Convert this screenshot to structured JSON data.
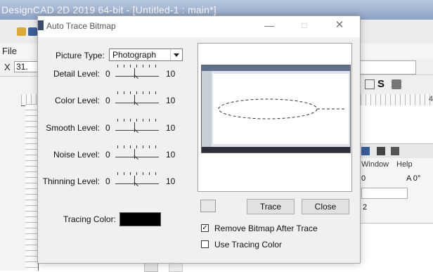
{
  "app": {
    "title": "DesignCAD 2D 2019 64-bit - [Untitled-1 : main*]",
    "menu_first": "File",
    "coord_label": "X",
    "coord_value": "31.",
    "ruler_number": "4",
    "right_toolbar_s": "S",
    "inner_window": {
      "menu_window": "Window",
      "menu_help": "Help",
      "field1": "0",
      "field1b": "A 0°",
      "field3": "2"
    }
  },
  "dialog": {
    "title": "Auto Trace Bitmap",
    "picture_type_label": "Picture Type:",
    "picture_type_value": "Photograph",
    "sliders": [
      {
        "label": "Detail Level:",
        "min": "0",
        "max": "10",
        "value": 5
      },
      {
        "label": "Color Level:",
        "min": "0",
        "max": "10",
        "value": 5
      },
      {
        "label": "Smooth Level:",
        "min": "0",
        "max": "10",
        "value": 5
      },
      {
        "label": "Noise Level:",
        "min": "0",
        "max": "10",
        "value": 5
      },
      {
        "label": "Thinning Level:",
        "min": "0",
        "max": "10",
        "value": 5
      }
    ],
    "tracing_color_label": "Tracing Color:",
    "tracing_color": "#000000",
    "trace_button": "Trace",
    "close_button": "Close",
    "remove_bitmap_label": "Remove Bitmap After Trace",
    "remove_bitmap_checked": true,
    "use_tracing_color_label": "Use Tracing Color",
    "use_tracing_color_checked": false
  }
}
